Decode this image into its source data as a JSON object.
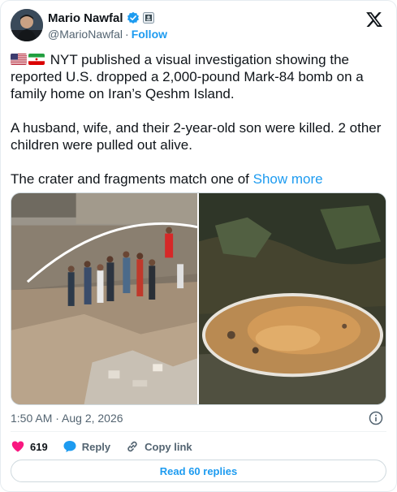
{
  "author": {
    "display_name": "Mario Nawfal",
    "handle": "@MarioNawfal",
    "separator": "·",
    "follow_label": "Follow",
    "verified_color": "#1d9bf0"
  },
  "post": {
    "paragraph1": "NYT published a visual investigation showing the reported U.S. dropped a 2,000-pound Mark-84 bomb on a family home on Iran’s Qeshm Island.",
    "paragraph2": "A husband, wife, and their 2-year-old son were killed. 2 other children were pulled out alive.",
    "paragraph3": "The crater and fragments match one of ",
    "show_more": "Show more",
    "flags": [
      "us-flag",
      "iran-flag"
    ]
  },
  "media": [
    {
      "name": "rescue-scene-photo",
      "icon": "photo"
    },
    {
      "name": "crater-photo",
      "icon": "photo"
    }
  ],
  "meta": {
    "timestamp": "1:50 AM · Aug 2, 2026"
  },
  "actions": {
    "like_count": "619",
    "reply_label": "Reply",
    "copy_link_label": "Copy link",
    "read_replies_label": "Read 60 replies"
  },
  "colors": {
    "accent": "#1d9bf0",
    "like": "#f91880",
    "text": "#0f1419",
    "muted": "#536471"
  }
}
